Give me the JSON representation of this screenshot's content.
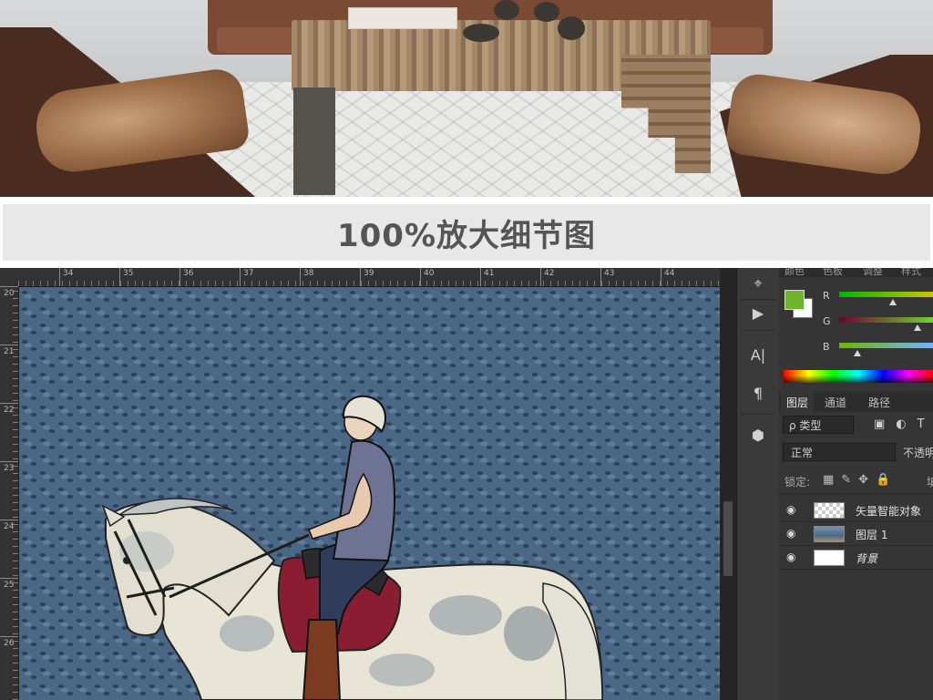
{
  "caption": {
    "title": "100%放大细节图"
  },
  "ruler": {
    "horizontal": [
      "34",
      "35",
      "36",
      "37",
      "38",
      "39",
      "40",
      "41",
      "42",
      "43",
      "44"
    ],
    "vertical": [
      "20",
      "21",
      "22",
      "23",
      "24",
      "25",
      "26"
    ]
  },
  "tools": {
    "items": [
      {
        "name": "path-selection-icon",
        "glyph": "⌖"
      },
      {
        "name": "play-icon",
        "glyph": "▶"
      },
      {
        "name": "character-icon",
        "glyph": "A|"
      },
      {
        "name": "paragraph-icon",
        "glyph": "¶"
      },
      {
        "name": "3d-icon",
        "glyph": "⬢"
      }
    ]
  },
  "color_panel": {
    "tabs": [
      "颜色",
      "色板",
      "调整",
      "样式"
    ],
    "foreground": "#6fb52c",
    "background": "#ffffff",
    "channels": [
      {
        "label": "R",
        "knob": 0.58
      },
      {
        "label": "G",
        "knob": 0.85
      },
      {
        "label": "B",
        "knob": 0.18
      }
    ]
  },
  "layers_panel": {
    "tabs": [
      "图层",
      "通道",
      "路径"
    ],
    "filter": "ρ 类型",
    "blend_mode": "正常",
    "opacity_label": "不透明",
    "lock_label": "锁定:",
    "fill_label": "填",
    "layers": [
      {
        "name": "矢量智能对象",
        "thumb": "checker"
      },
      {
        "name": "图层 1",
        "thumb": "photo"
      },
      {
        "name": "背景",
        "thumb": "white"
      }
    ]
  }
}
